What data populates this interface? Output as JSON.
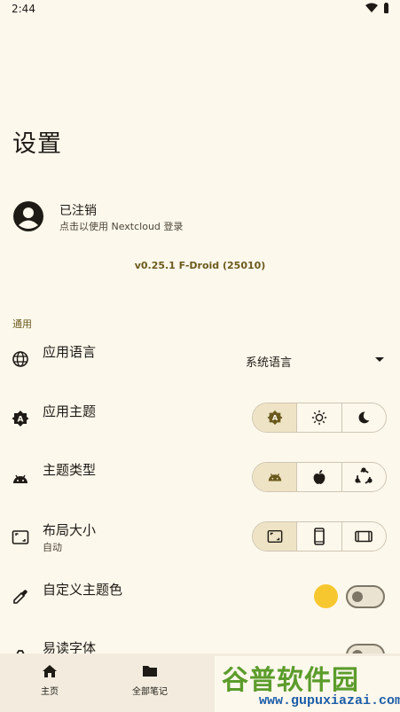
{
  "status_bar": {
    "time": "2:44"
  },
  "page": {
    "title": "设置"
  },
  "account": {
    "title": "已注销",
    "subtitle": "点击以使用 Nextcloud 登录"
  },
  "version": "v0.25.1 F-Droid (25010)",
  "section": {
    "general": "通用"
  },
  "settings": {
    "language": {
      "title": "应用语言",
      "value": "系统语言"
    },
    "app_theme": {
      "title": "应用主题",
      "options": [
        "auto-theme-icon",
        "sun-icon",
        "moon-icon"
      ],
      "selected_index": 0
    },
    "theme_type": {
      "title": "主题类型",
      "options": [
        "android-icon",
        "apple-icon",
        "ubuntu-icon"
      ],
      "selected_index": 0
    },
    "layout_size": {
      "title": "布局大小",
      "subtitle": "自动",
      "options": [
        "fit-screen-icon",
        "phone-icon",
        "tablet-icon"
      ],
      "selected_index": 0
    },
    "custom_color": {
      "title": "自定义主题色",
      "color": "#f7c72f",
      "enabled": false
    },
    "readable_font": {
      "title": "易读字体",
      "enabled": false
    }
  },
  "bottom_nav": [
    {
      "label": "主页",
      "icon": "home-icon"
    },
    {
      "label": "全部笔记",
      "icon": "folder-icon"
    }
  ],
  "watermark": {
    "text": "谷普软件园",
    "url": "www.gupuxiazai.com"
  }
}
